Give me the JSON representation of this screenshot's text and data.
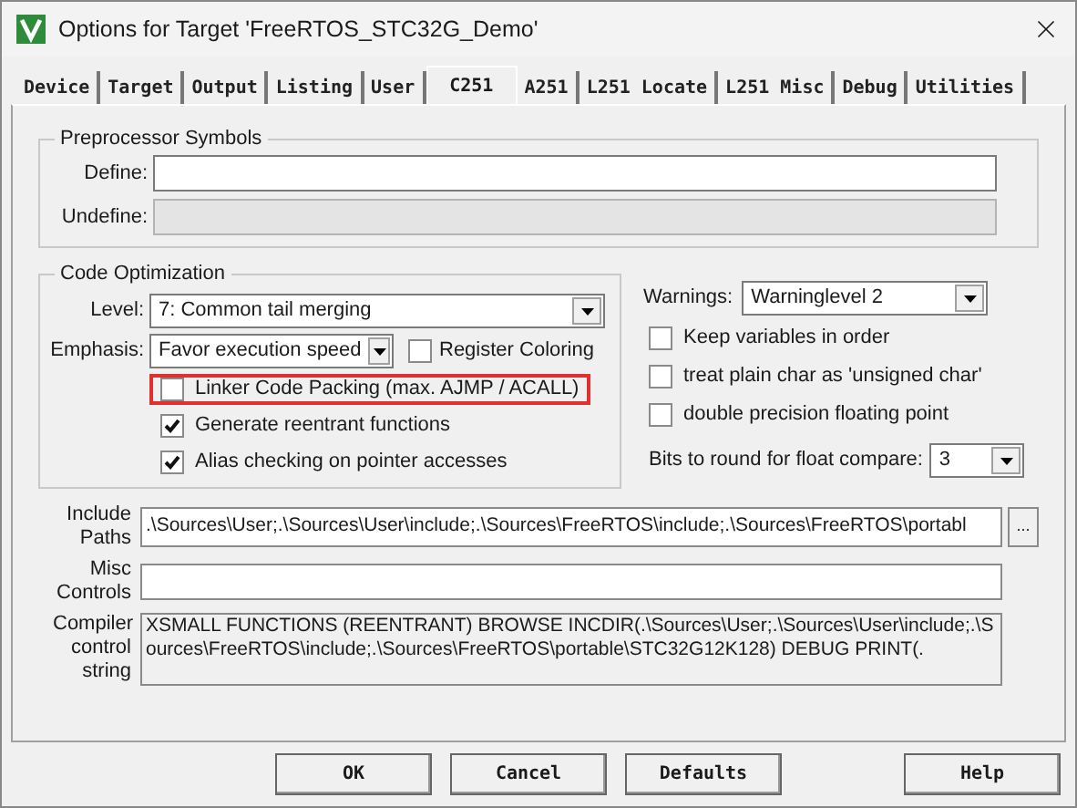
{
  "window": {
    "title": "Options for Target 'FreeRTOS_STC32G_Demo'"
  },
  "tabs": [
    {
      "label": "Device",
      "selected": false
    },
    {
      "label": "Target",
      "selected": false
    },
    {
      "label": "Output",
      "selected": false
    },
    {
      "label": "Listing",
      "selected": false
    },
    {
      "label": "User",
      "selected": false
    },
    {
      "label": "C251",
      "selected": true
    },
    {
      "label": "A251",
      "selected": false
    },
    {
      "label": "L251 Locate",
      "selected": false
    },
    {
      "label": "L251 Misc",
      "selected": false
    },
    {
      "label": "Debug",
      "selected": false
    },
    {
      "label": "Utilities",
      "selected": false
    }
  ],
  "preprocessor": {
    "title": "Preprocessor Symbols",
    "fields": [
      {
        "label": "Define:",
        "disabled": false
      },
      {
        "label": "Undefine:",
        "disabled": true
      }
    ]
  },
  "optimization": {
    "title": "Code Optimization",
    "level": {
      "label": "Level:",
      "value": "7: Common tail merging"
    },
    "emphasis": {
      "label": "Emphasis:",
      "value": "Favor execution speed"
    },
    "register_coloring": {
      "label": "Register Coloring",
      "checked": false
    },
    "options": [
      {
        "label": "Linker Code Packing (max. AJMP / ACALL)",
        "checked": false,
        "highlighted": true
      },
      {
        "label": "Generate reentrant functions",
        "checked": true,
        "highlighted": false
      },
      {
        "label": "Alias checking on pointer accesses",
        "checked": true,
        "highlighted": false
      }
    ]
  },
  "warnings": {
    "label": "Warnings:",
    "value": "Warninglevel 2"
  },
  "right_options": [
    {
      "label": "Keep variables in order",
      "checked": false
    },
    {
      "label": "treat plain char as 'unsigned char'",
      "checked": false
    },
    {
      "label": "double precision floating point",
      "checked": false
    }
  ],
  "bits": {
    "label": "Bits to round for float compare:",
    "value": "3"
  },
  "include_paths": {
    "label": "Include Paths",
    "value": ".\\Sources\\User;.\\Sources\\User\\include;.\\Sources\\FreeRTOS\\include;.\\Sources\\FreeRTOS\\portabl",
    "browse": "..."
  },
  "misc_controls": {
    "label": "Misc Controls"
  },
  "compiler_string": {
    "label": "Compiler control string",
    "value": "XSMALL FUNCTIONS (REENTRANT) BROWSE INCDIR(.\\Sources\\User;.\\Sources\\User\\include;.\\Sources\\FreeRTOS\\include;.\\Sources\\FreeRTOS\\portable\\STC32G12K128) DEBUG PRINT(."
  },
  "buttons": [
    "OK",
    "Cancel",
    "Defaults",
    "Help"
  ]
}
